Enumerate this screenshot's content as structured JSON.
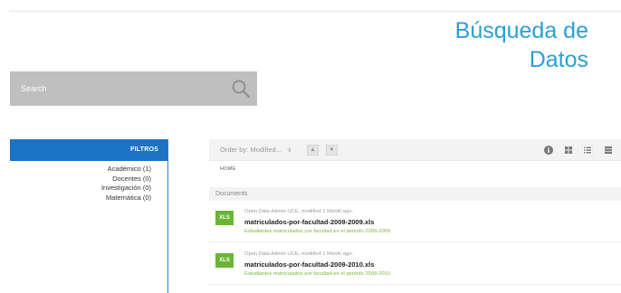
{
  "header": {
    "title_line1": "Búsqueda de",
    "title_line2": "Datos"
  },
  "search": {
    "placeholder": "Search"
  },
  "filters": {
    "header": "FILTROS",
    "items": [
      {
        "label": "Académico (1)"
      },
      {
        "label": "Docentes (0)"
      },
      {
        "label": "Investigación (0)"
      },
      {
        "label": "Matemática (0)"
      }
    ]
  },
  "toolbar": {
    "order_by": "Order by: Modified...",
    "order_caret": "⇕",
    "asc_symbol": "▲",
    "desc_symbol": "▼"
  },
  "breadcrumb": "HOME",
  "section": {
    "label": "Documents"
  },
  "documents": [
    {
      "type": "XLS",
      "meta": "Open Data Admin UCE, modified 1 Month ago.",
      "title": "matriculados-por-facultad-2009-2009.xls",
      "description": "Estudiantes matriculados por facultad en el periodo 2009-2009"
    },
    {
      "type": "XLS",
      "meta": "Open Data Admin UCE, modified 1 Month ago.",
      "title": "matriculados-por-facultad-2009-2010.xls",
      "description": "Estudiantes matriculados por facultad en el periodo 2009-2010"
    }
  ],
  "colors": {
    "accent": "#2a9fd6",
    "filters_header": "#1c73c6",
    "badge": "#6ab538",
    "description": "#7ab83c"
  }
}
